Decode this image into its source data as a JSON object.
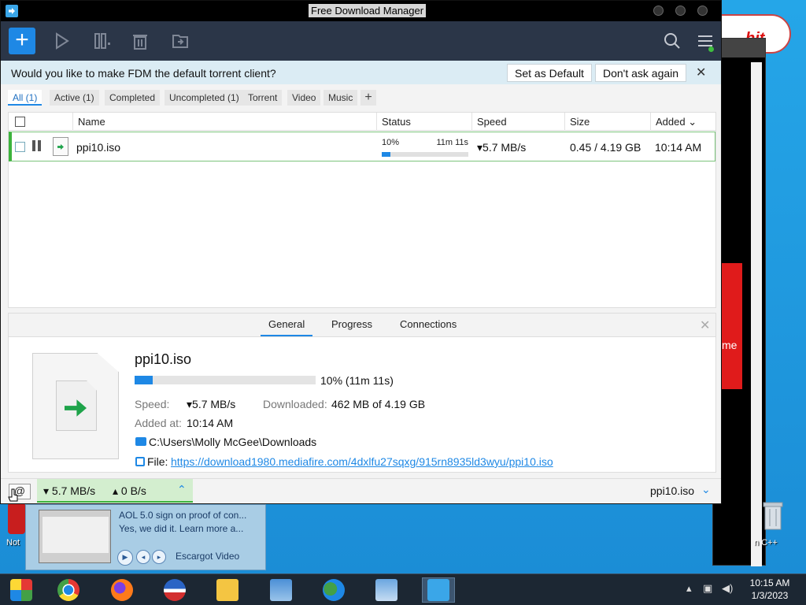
{
  "window": {
    "title": "Free Download Manager"
  },
  "notice": {
    "message": "Would you like to make FDM the default torrent client?",
    "set_default": "Set as Default",
    "dont_ask": "Don't ask again",
    "close": "✕"
  },
  "filter_tabs": [
    "All (1)",
    "Active (1)",
    "Completed",
    "Uncompleted (1)",
    "Torrent",
    "Video",
    "Music"
  ],
  "table": {
    "columns": {
      "name": "Name",
      "status": "Status",
      "speed": "Speed",
      "size": "Size",
      "added": "Added ⌄"
    },
    "rows": [
      {
        "name": "ppi10.iso",
        "status_pct": "10%",
        "status_eta": "11m 11s",
        "progress": 0.1,
        "speed": "▾5.7 MB/s",
        "size": "0.45 / 4.19 GB",
        "added": "10:14 AM"
      }
    ]
  },
  "details": {
    "tabs": [
      "General",
      "Progress",
      "Connections"
    ],
    "close": "✕",
    "file_name": "ppi10.iso",
    "progress": 0.1,
    "progress_text": "10% (11m 11s)",
    "speed_label": "Speed:",
    "speed_value": "▾5.7 MB/s",
    "downloaded_label": "Downloaded:",
    "downloaded_value": "462 MB of 4.19 GB",
    "added_label": "Added at:",
    "added_value": "10:14 AM",
    "folder": "C:\\Users\\Molly McGee\\Downloads",
    "file_label": "File:",
    "file_url": "https://download1980.mediafire.com/4dxlfu27sqxg/915rn8935ld3wyu/ppi10.iso"
  },
  "statusbar": {
    "down": "▾ 5.7 MB/s",
    "up": "▴ 0 B/s",
    "chevron": "⌃",
    "current_file": "ppi10.iso",
    "current_chevron": "⌄"
  },
  "thumbnail": {
    "line1": "AOL 5.0 sign on proof of con...",
    "line2": "Yes, we did it. Learn more a...",
    "app": "Escargot Video"
  },
  "desktop": {
    "left_label": "Not",
    "right_label": "n C++",
    "red_text": "me",
    "blob_text": "hit"
  },
  "clock": {
    "time": "10:15 AM",
    "date": "1/3/2023"
  },
  "colors": {
    "accent": "#1e88e5",
    "toolbar": "#2b3648",
    "notice": "#dbecf4",
    "active_row": "#3cb33c"
  }
}
